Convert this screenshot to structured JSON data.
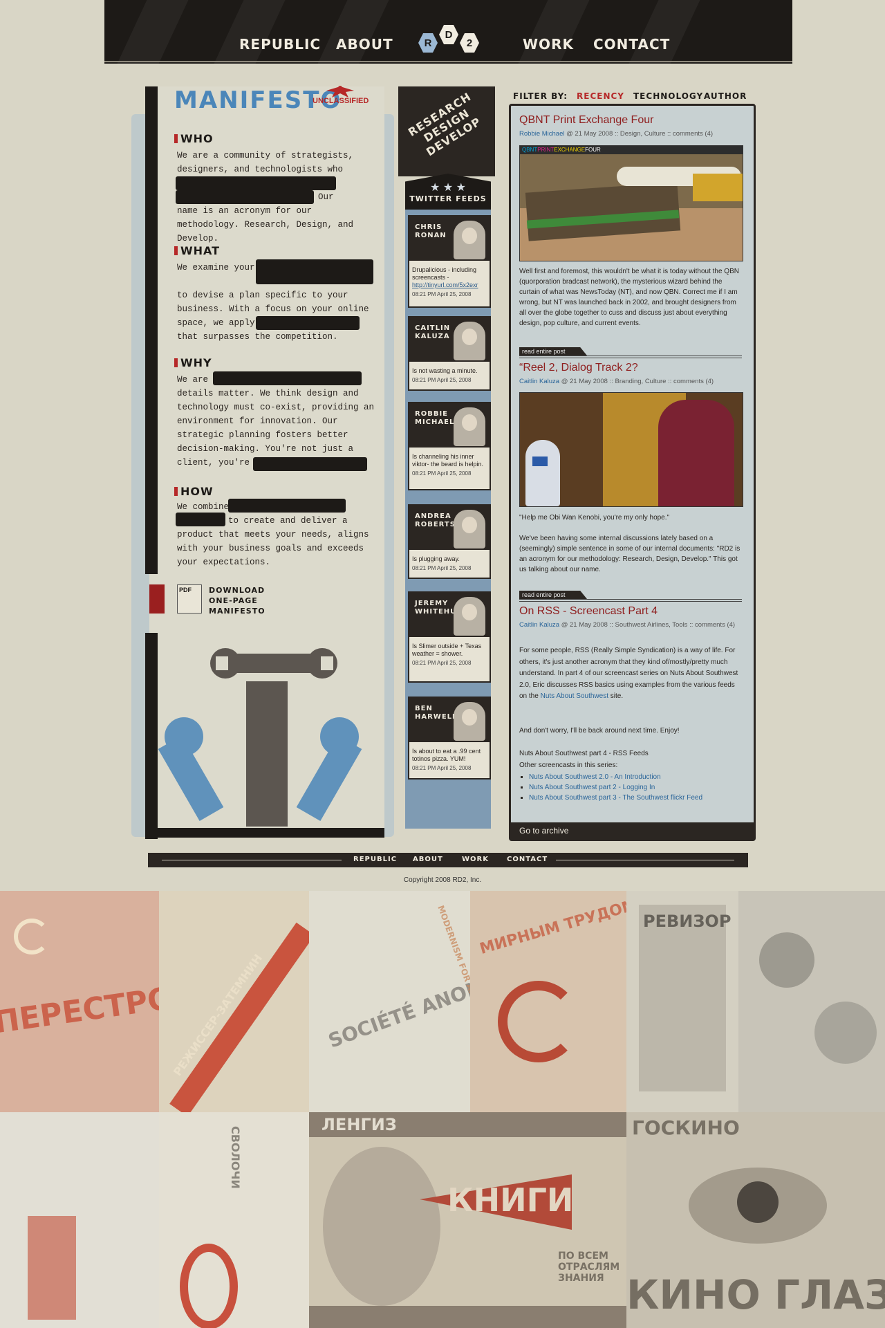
{
  "nav": {
    "republic": "Republic",
    "about": "About",
    "work": "Work",
    "contact": "Contact"
  },
  "logo": {
    "r": "R",
    "d": "D",
    "two": "2"
  },
  "manifesto": {
    "title": "Manifesto",
    "stamp": "UNCLASSIFIED",
    "who_head": "Who",
    "who_text_1": "We are a community of strategists, designers, and technologists who",
    "who_text_2": "Our",
    "who_text_3": "name is an acronym for our methodology. Research, Design, and Develop.",
    "what_head": "What",
    "what_text_1": "We examine your",
    "what_text_2": "to devise a plan specific to your business. With a focus on your online space, we apply",
    "what_text_3": "that surpasses the competition.",
    "why_head": "Why",
    "why_text_1": "We are",
    "why_text_2": "details matter. We think design and technology must co-exist, providing an environment for innovation. Our strategic planning fosters better decision-making. You're not just a client, you're a",
    "how_head": "How",
    "how_text_1": "We combine",
    "how_text_2": "to create and deliver a product that meets your needs, aligns with your business goals and exceeds your expectations.",
    "pdf_label": "PDF",
    "download": "Download One-Page Manifesto"
  },
  "banner": {
    "text": "Research Design Develop"
  },
  "twitter": {
    "header": "Twitter Feeds",
    "stars": "★ ★ ★",
    "tweets": [
      {
        "name": "Chris Ronan",
        "text": "Drupalicious - including screencasts -",
        "link": "http://tinyurl.com/5x2exr",
        "time": "08:21 PM April 25, 2008"
      },
      {
        "name": "Caitlin Kaluza",
        "text": "Is not wasting a minute.",
        "time": "08:21 PM April 25, 2008"
      },
      {
        "name": "Robbie Michael",
        "text": "Is channeling his inner viktor- the beard is helpin.",
        "time": "08:21 PM April 25, 2008"
      },
      {
        "name": "Andrea Roberts",
        "text": "Is plugging away.",
        "time": "08:21 PM April 25, 2008"
      },
      {
        "name": "Jeremy Whitehurst",
        "text": "Is Slimer outside + Texas weather = shower.",
        "time": "08:21 PM April 25, 2008"
      },
      {
        "name": "Ben Harwell",
        "text": "Is about to eat a .99 cent totinos pizza. YUM!",
        "time": "08:21 PM April 25, 2008"
      }
    ]
  },
  "filter": {
    "label": "Filter by:",
    "recency": "Recency",
    "technology": "Technology",
    "author": "Author"
  },
  "posts": [
    {
      "title": "QBNT Print Exchange Four",
      "author": "Robbie Michael",
      "date": "@ 21 May 2008 ::",
      "cats": "Design, Culture",
      "comments": ":: comments (4)",
      "banner_q": "QBNT",
      "banner_print": "PRINT",
      "banner_ex": "EXCHANGE",
      "banner_four": "FOUR",
      "body": "Well first and foremost, this wouldn't be what it is today without the QBN (quorporation bradcast network), the mysterious wizard behind the curtain of what was NewsToday (NT), and now QBN. Correct me if I am wrong, but NT was launched back in 2002, and brought designers from all over the globe together to cuss and discuss just about everything design, pop culture, and current events.",
      "readmore": "read entire post"
    },
    {
      "title": "“Reel 2, Dialog Track 2?",
      "author": "Caitlin Kaluza",
      "date": "@ 21 May 2008 ::",
      "cats": "Branding, Culture",
      "comments": ":: comments (4)",
      "body1": "\"Help me Obi Wan Kenobi, you're my only hope.\"",
      "body2": "We've been having some internal discussions lately based on a (seemingly) simple sentence in some of our internal documents: \"RD2 is an acronym for our methodology: Research, Design, Develop.\" This got us talking about our name.",
      "readmore": "read entire post"
    },
    {
      "title": "On RSS - Screencast Part 4",
      "author": "Caitlin Kaluza",
      "date": "@ 21 May 2008 ::",
      "cats": "Southwest Airlines, Tools",
      "comments": ":: comments (4)",
      "body1": "For some people, RSS (Really Simple Syndication) is a way of life. For others, it's just another acronym that they kind of/mostly/pretty much understand. In part 4 of our screencast series on Nuts About Southwest 2.0, Eric discusses RSS basics using examples from the various feeds on the",
      "body1_link": "Nuts About Southwest",
      "body1_end": "site.",
      "body2": "And don't worry, I'll be back around next time. Enjoy!",
      "body3": "Nuts About Southwest part 4 - RSS Feeds",
      "body4": "Other screencasts in this series:",
      "links": [
        "Nuts About Southwest 2.0 - An Introduction",
        "Nuts About Southwest part 2 - Logging In",
        "Nuts About Southwest part 3 - The Southwest flickr Feed"
      ]
    }
  ],
  "archive": "Go to archive",
  "footer": {
    "republic": "Republic",
    "about": "About",
    "work": "Work",
    "contact": "Contact",
    "copyright": "Copyright 2008 RD2, Inc."
  },
  "posters": {
    "p1": "ПЕРЕСТРОЙКА",
    "p2": "РЕЖИССЕР-ЗАТЕМНИН",
    "p3": "SOCIÉTÉ ANONYME",
    "p3b": "MODERNISM FOR AMERICA",
    "p4": "МИРНЫМ ТРУДОМ",
    "p5": "РЕВИЗОР",
    "p6": "ГОСКИНО",
    "p7": "ЛЕНГИЗ",
    "p7b": "КНИГИ",
    "p7c": "ПО ВСЕМ ОТРАСЛЯМ ЗНАНИЯ",
    "p8": "КИНО ГЛАЗ",
    "p9": "СВОЛОЧИ"
  }
}
